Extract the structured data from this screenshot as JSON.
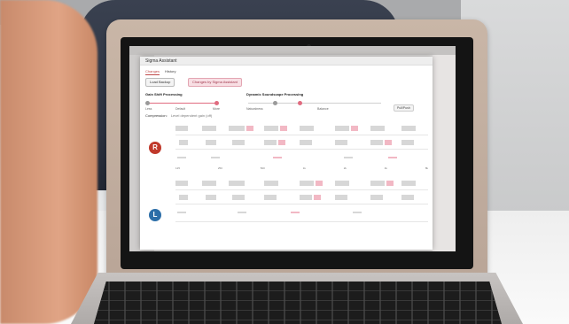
{
  "dialog": {
    "title": "Sigma Assistant",
    "tabs": [
      "Changes",
      "History"
    ],
    "buttons": {
      "left": "Load Backup",
      "right": "Changes by Sigma Assistant"
    },
    "sections": {
      "gain_label": "Gain Shift Processing",
      "dynamic_label": "Dynamic Soundscape Processing"
    },
    "slider_labels": {
      "left_min": "Less",
      "left_mid": "Default",
      "left_max": "More",
      "right_left": "Naturalness",
      "right_right": "Balance"
    },
    "right_button": "Pull/Push",
    "compression_label": "Compression:",
    "compression_value": "Level dependent gain (off)",
    "ear_badges": [
      "R",
      "L"
    ],
    "axis_ticks": [
      "125",
      "250",
      "500",
      "1k",
      "2k",
      "4k",
      "8k"
    ]
  },
  "colors": {
    "accent": "#e06b7f",
    "right_ear": "#c0392b",
    "left_ear": "#2c6ea8"
  }
}
